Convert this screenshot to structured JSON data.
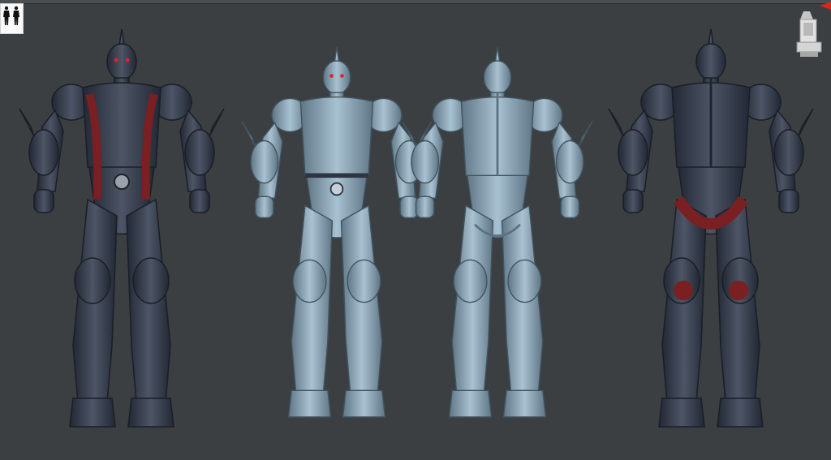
{
  "app": {
    "kind": "3D sculpting viewport",
    "views": [
      {
        "name": "front",
        "material": "dark"
      },
      {
        "name": "front",
        "material": "light"
      },
      {
        "name": "back",
        "material": "light"
      },
      {
        "name": "back",
        "material": "dark"
      }
    ]
  },
  "icons": {
    "thumbnail": "figure-thumbnail-icon",
    "navigation": "view-cube-gizmo-icon",
    "marker": "red-triangle-marker-icon"
  },
  "colors": {
    "background": "#3b3f41",
    "dark_armor": "#2e3442",
    "dark_highlight": "#4d5566",
    "red_muscle": "#7a1f22",
    "light_armor": "#7d99ab",
    "light_highlight": "#a9c2d1",
    "eyes": "#e2202a"
  }
}
